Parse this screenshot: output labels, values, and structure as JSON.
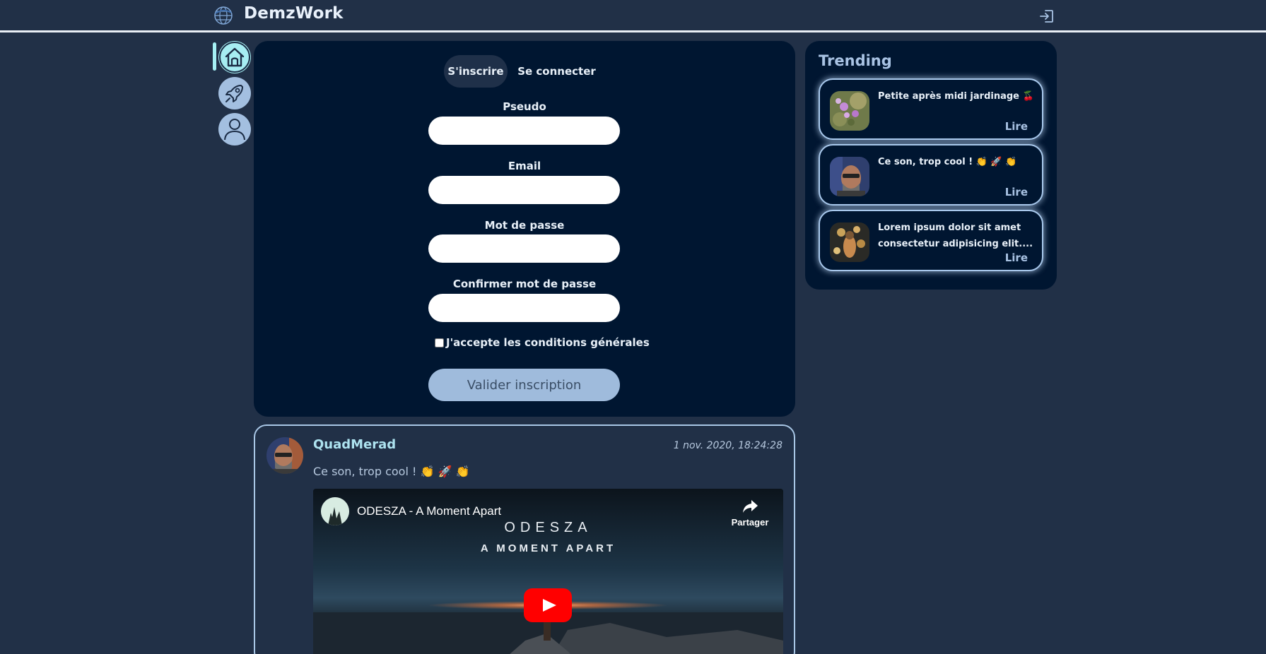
{
  "header": {
    "brand": "DemzWork",
    "logo_icon": "globe-logo-icon",
    "logout_icon": "logout-icon"
  },
  "nav": {
    "items": [
      {
        "name": "home",
        "icon": "home-icon",
        "active": true
      },
      {
        "name": "explore",
        "icon": "rocket-icon",
        "active": false
      },
      {
        "name": "profile",
        "icon": "user-icon",
        "active": false
      }
    ]
  },
  "auth": {
    "tabs": [
      {
        "label": "S'inscrire",
        "active": true
      },
      {
        "label": "Se connecter",
        "active": false
      }
    ],
    "fields": [
      {
        "label": "Pseudo",
        "value": ""
      },
      {
        "label": "Email",
        "value": ""
      },
      {
        "label": "Mot de passe",
        "value": ""
      },
      {
        "label": "Confirmer mot de passe",
        "value": ""
      }
    ],
    "terms_label": "J'accepte les conditions générales",
    "terms_checked": false,
    "submit_label": "Valider inscription"
  },
  "trending": {
    "title": "Trending",
    "items": [
      {
        "text": "Petite après midi jardinage 🍒",
        "read_label": "Lire"
      },
      {
        "text": "Ce son, trop cool ! 👏 🚀 👏",
        "read_label": "Lire"
      },
      {
        "text": "Lorem ipsum dolor sit amet consectetur adipisicing elit....",
        "read_label": "Lire"
      }
    ]
  },
  "post": {
    "author": "QuadMerad",
    "date": "1 nov. 2020, 18:24:28",
    "text": "Ce son, trop cool ! 👏 🚀 👏",
    "video": {
      "title": "ODESZA - A Moment Apart",
      "share_label": "Partager",
      "overlay_line1": "ODESZA",
      "overlay_line2": "A MOMENT APART",
      "play_icon": "youtube-play-icon"
    }
  },
  "colors": {
    "background": "#213047",
    "card": "#001631",
    "accent": "#a6edf2",
    "muted": "#a9c3e4",
    "button": "#9fbbdc",
    "play": "#ff0000"
  }
}
